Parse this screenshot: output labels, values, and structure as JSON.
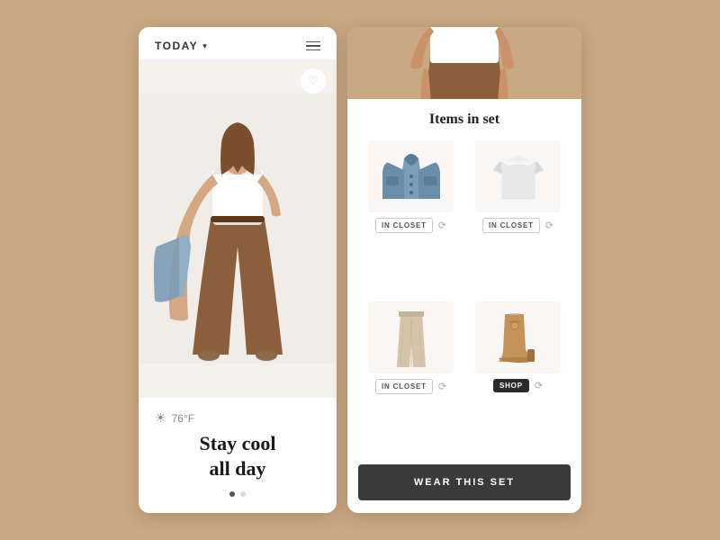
{
  "left_panel": {
    "today_label": "TODAY",
    "today_arrow": "▾",
    "weather": {
      "icon": "☀",
      "temperature": "76°F"
    },
    "outfit_title_line1": "Stay cool",
    "outfit_title_line2": "all day",
    "dots": [
      "active",
      "inactive"
    ]
  },
  "right_panel": {
    "section_title": "Items in set",
    "items": [
      {
        "name": "Denim Jacket",
        "action": "IN CLOSET",
        "type": "in-closet"
      },
      {
        "name": "White T-Shirt",
        "action": "IN CLOSET",
        "type": "in-closet"
      },
      {
        "name": "Wide Leg Pants",
        "action": "IN CLOSET",
        "type": "in-closet"
      },
      {
        "name": "Ankle Boots",
        "action": "SHOP",
        "type": "shop"
      }
    ],
    "wear_set_label": "WEAR THIS SET"
  },
  "icons": {
    "menu": "menu-icon",
    "heart": "♡",
    "swap": "⟳"
  }
}
